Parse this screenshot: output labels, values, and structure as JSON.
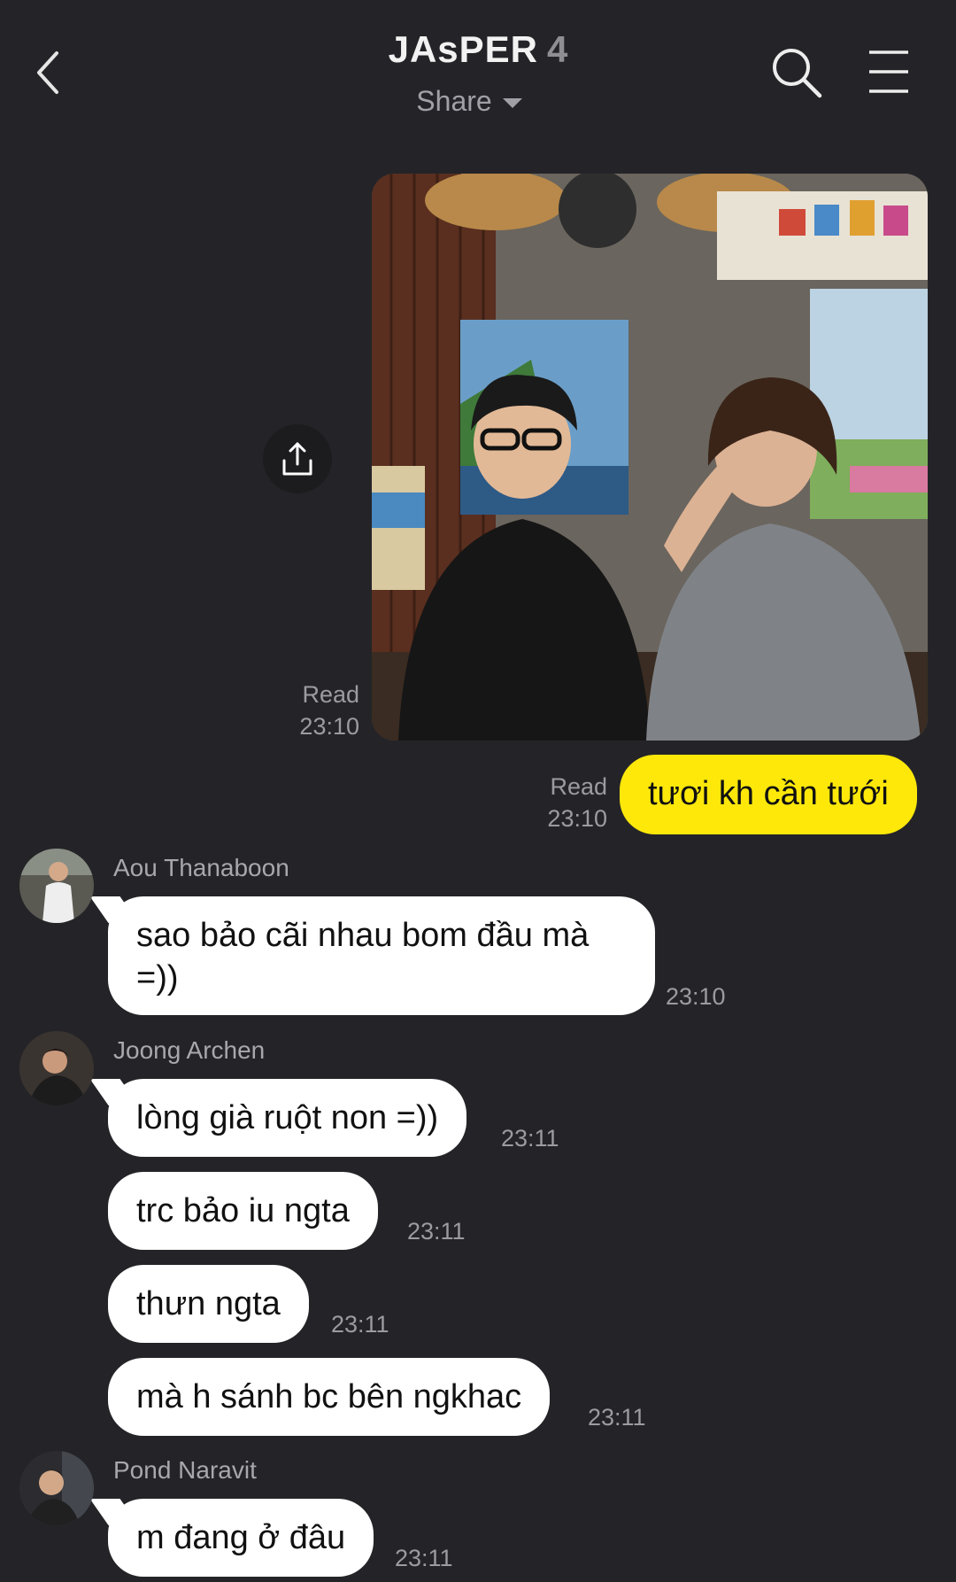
{
  "header": {
    "title": "JAsPER",
    "member_count": "4",
    "subtitle": "Share"
  },
  "messages": {
    "photo": {
      "read": "Read",
      "time": "23:10"
    },
    "own_text": {
      "text": "tươi kh cần tưới",
      "read": "Read",
      "time": "23:10"
    },
    "aou": {
      "sender": "Aou Thanaboon",
      "lines": [
        "sao bảo cãi nhau bom đầu mà",
        "=))"
      ],
      "time": "23:10"
    },
    "joong": {
      "sender": "Joong Archen",
      "items": [
        {
          "text": "lòng già ruột non =))",
          "time": "23:11"
        },
        {
          "text": "trc bảo iu ngta",
          "time": "23:11"
        },
        {
          "text": "thưn ngta",
          "time": "23:11"
        },
        {
          "text": "mà h sánh bc bên ngkhac",
          "time": "23:11"
        }
      ]
    },
    "pond": {
      "sender": "Pond Naravit",
      "text": "m đang ở đâu",
      "time": "23:11"
    }
  },
  "colors": {
    "background": "#242428",
    "own_bubble": "#fde80a",
    "other_bubble": "#ffffff",
    "muted_text": "#9b9ba0"
  },
  "icons": [
    "back-chevron-icon",
    "search-icon",
    "menu-icon",
    "share-upload-icon"
  ]
}
